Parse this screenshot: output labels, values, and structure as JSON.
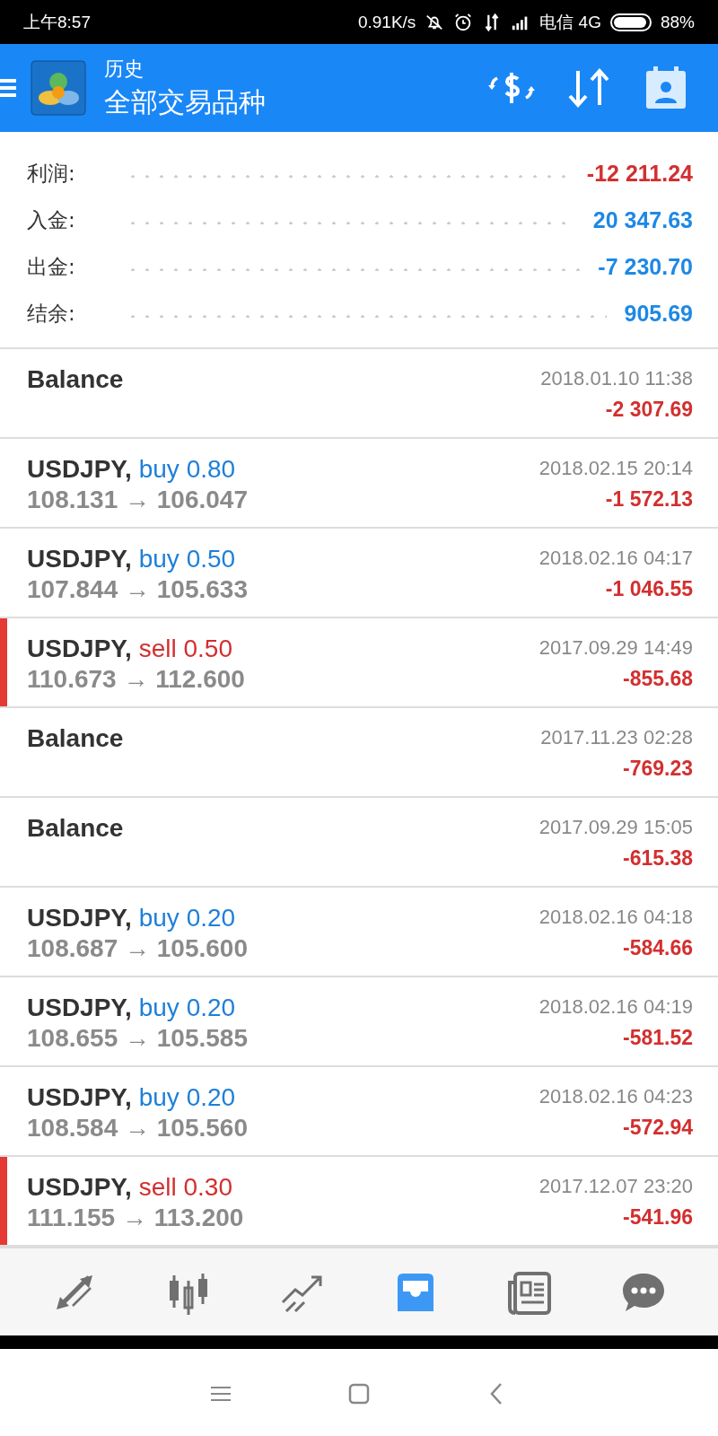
{
  "status_bar": {
    "time": "上午8:57",
    "speed": "0.91K/s",
    "carrier": "电信 4G",
    "battery": "88%"
  },
  "header": {
    "title": "历史",
    "subtitle": "全部交易品种"
  },
  "summary": [
    {
      "label": "利润:",
      "value": "-12 211.24",
      "color": "#d32f2f"
    },
    {
      "label": "入金:",
      "value": "20 347.63",
      "color": "#1e88e5"
    },
    {
      "label": "出金:",
      "value": "-7 230.70",
      "color": "#1e88e5"
    },
    {
      "label": "结余:",
      "value": "905.69",
      "color": "#1e88e5"
    }
  ],
  "history": [
    {
      "kind": "balance",
      "title": "Balance",
      "time": "2018.01.10 11:38",
      "profit": "-2 307.69"
    },
    {
      "kind": "buy",
      "symbol": "USDJPY,",
      "volume": "buy 0.80",
      "prices": "108.131 → 106.047",
      "time": "2018.02.15 20:14",
      "profit": "-1 572.13"
    },
    {
      "kind": "buy",
      "symbol": "USDJPY,",
      "volume": "buy 0.50",
      "prices": "107.844 → 105.633",
      "time": "2018.02.16 04:17",
      "profit": "-1 046.55"
    },
    {
      "kind": "sell",
      "symbol": "USDJPY,",
      "volume": "sell 0.50",
      "prices": "110.673 → 112.600",
      "time": "2017.09.29 14:49",
      "profit": "-855.68"
    },
    {
      "kind": "balance",
      "title": "Balance",
      "time": "2017.11.23 02:28",
      "profit": "-769.23"
    },
    {
      "kind": "balance",
      "title": "Balance",
      "time": "2017.09.29 15:05",
      "profit": "-615.38"
    },
    {
      "kind": "buy",
      "symbol": "USDJPY,",
      "volume": "buy 0.20",
      "prices": "108.687 → 105.600",
      "time": "2018.02.16 04:18",
      "profit": "-584.66"
    },
    {
      "kind": "buy",
      "symbol": "USDJPY,",
      "volume": "buy 0.20",
      "prices": "108.655 → 105.585",
      "time": "2018.02.16 04:19",
      "profit": "-581.52"
    },
    {
      "kind": "buy",
      "symbol": "USDJPY,",
      "volume": "buy 0.20",
      "prices": "108.584 → 105.560",
      "time": "2018.02.16 04:23",
      "profit": "-572.94"
    },
    {
      "kind": "sell",
      "symbol": "USDJPY,",
      "volume": "sell 0.30",
      "prices": "111.155 → 113.200",
      "time": "2017.12.07 23:20",
      "profit": "-541.96"
    }
  ],
  "bottom_nav": [
    {
      "kind": "quotes",
      "selected": false
    },
    {
      "kind": "chart",
      "selected": false
    },
    {
      "kind": "trade",
      "selected": false
    },
    {
      "kind": "history",
      "selected": true
    },
    {
      "kind": "news",
      "selected": false
    },
    {
      "kind": "chat",
      "selected": false
    }
  ]
}
